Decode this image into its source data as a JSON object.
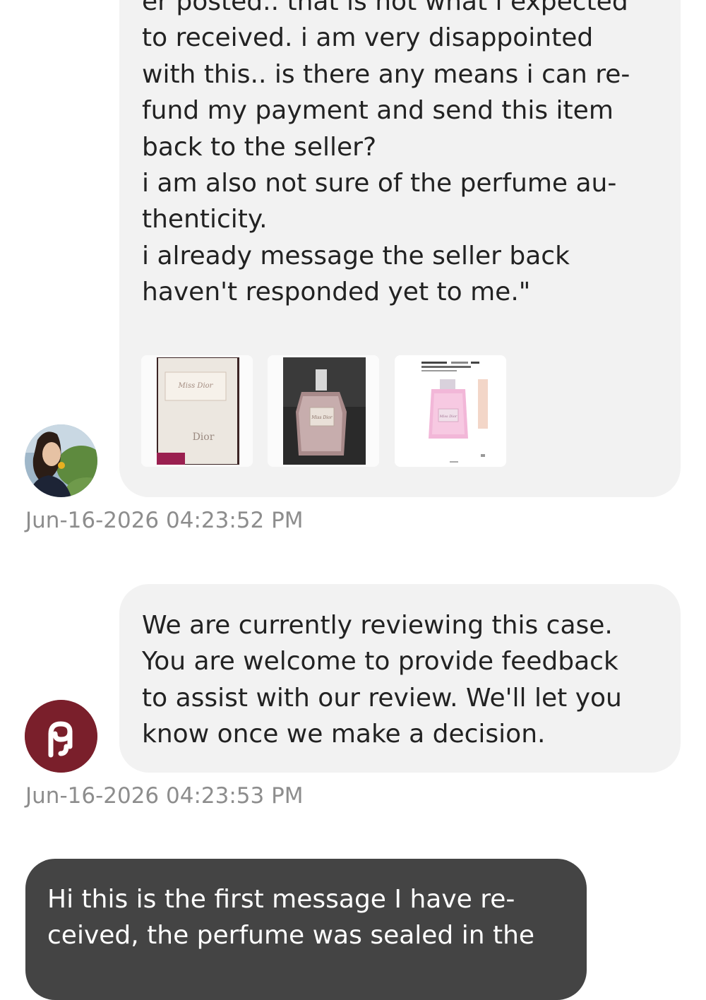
{
  "thread": {
    "messages": [
      {
        "lines": [
          "er posted.. that is not what i expected",
          "to received. i am very disappointed",
          "with this.. is there any means i can re-",
          "fund my payment and send this item",
          "back to the seller?",
          "i am also not sure of the perfume au-",
          "thenticity.",
          "i already message the seller back",
          "haven't responded yet to me.\""
        ],
        "attachments": [
          {
            "icon": "perfume-box-photo",
            "box_label": "Miss Dior",
            "brand": "Dior"
          },
          {
            "icon": "perfume-bottle-photo",
            "label": "Miss Dior"
          },
          {
            "icon": "listing-screenshot-photo",
            "label": "Miss Dior"
          }
        ],
        "timestamp": "Jun-16-2026 04:23:52 PM"
      },
      {
        "lines": [
          "We are currently reviewing this case.",
          "You are welcome to provide feedback",
          "to assist with our review. We'll let you",
          "know once we make a decision."
        ],
        "timestamp": "Jun-16-2026 04:23:53 PM"
      },
      {
        "lines": [
          "Hi this is the first message I have re-",
          "ceived, the perfume was sealed in the"
        ]
      }
    ]
  },
  "colors": {
    "incoming_bubble": "#f2f2f2",
    "outgoing_bubble": "#444444",
    "timestamp_text": "#8d8d8d",
    "brand_avatar": "#7a1f2b"
  },
  "icons": {
    "buyer_avatar": "user-photo-avatar",
    "support_avatar": "poshmark-logo-icon"
  }
}
